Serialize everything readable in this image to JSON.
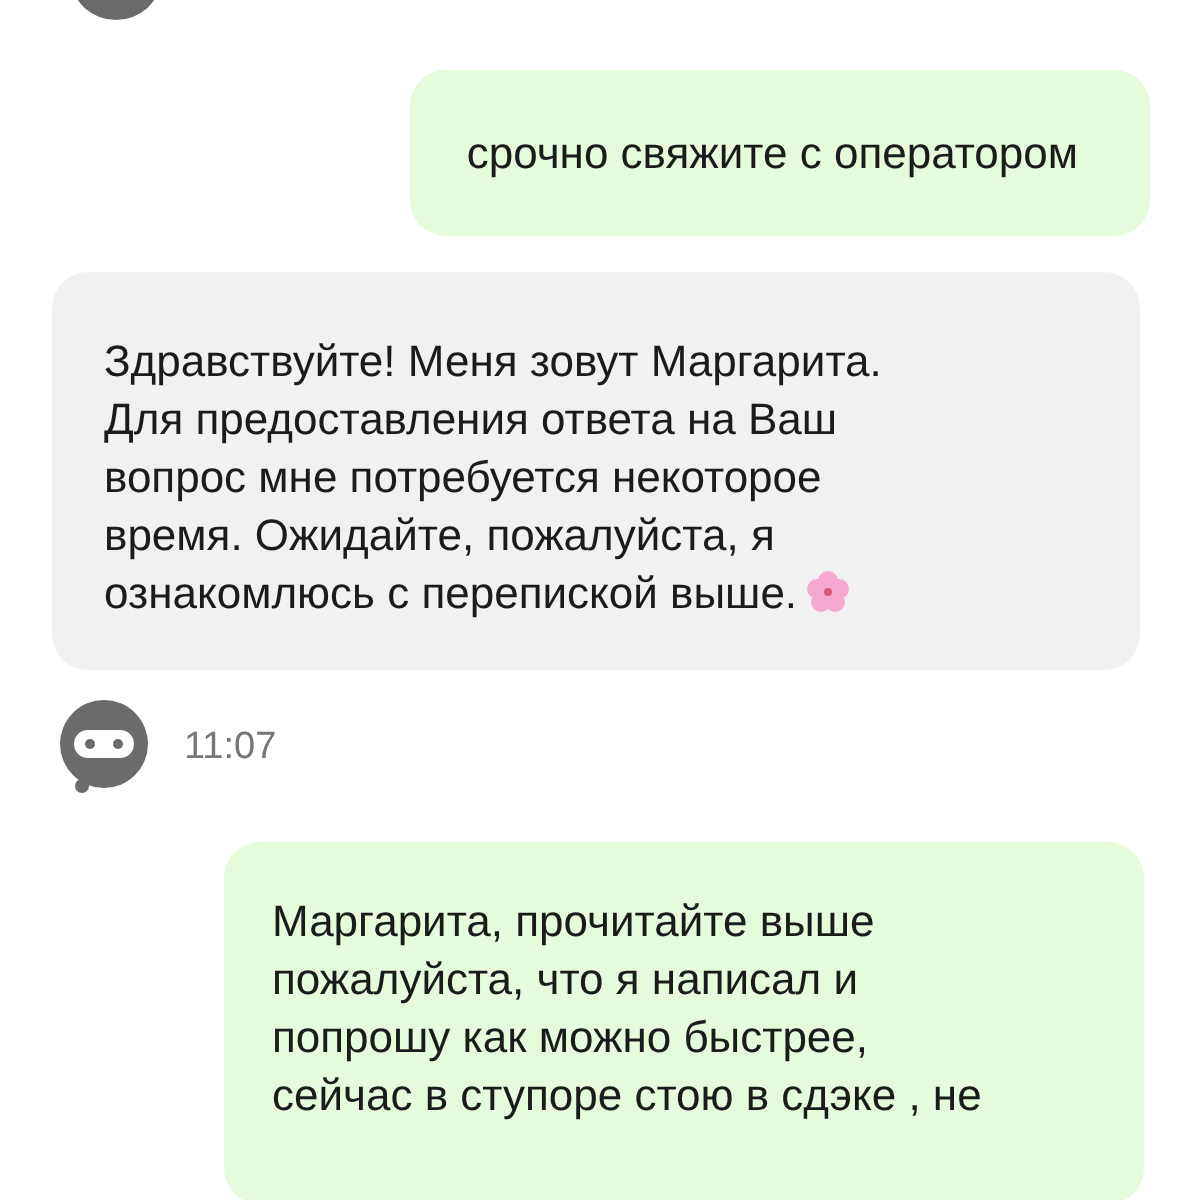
{
  "messages": [
    {
      "kind": "outgoing",
      "text": "срочно свяжите с оператором"
    },
    {
      "kind": "incoming",
      "text": "Здравствуйте! Меня зовут Маргарита.\nДля предоставления ответа на Ваш\nвопрос мне потребуется некоторое\nвремя. Ожидайте, пожалуйста, я\nознакомлюсь с перепиской выше.",
      "flower": true
    },
    {
      "kind": "bot-time",
      "time": "11:07"
    },
    {
      "kind": "outgoing",
      "text": "Маргарита, прочитайте выше\nпожалуйста, что я написал и\nпопрошу как можно быстрее,\nсейчас в ступоре стою в сдэке , не"
    }
  ]
}
